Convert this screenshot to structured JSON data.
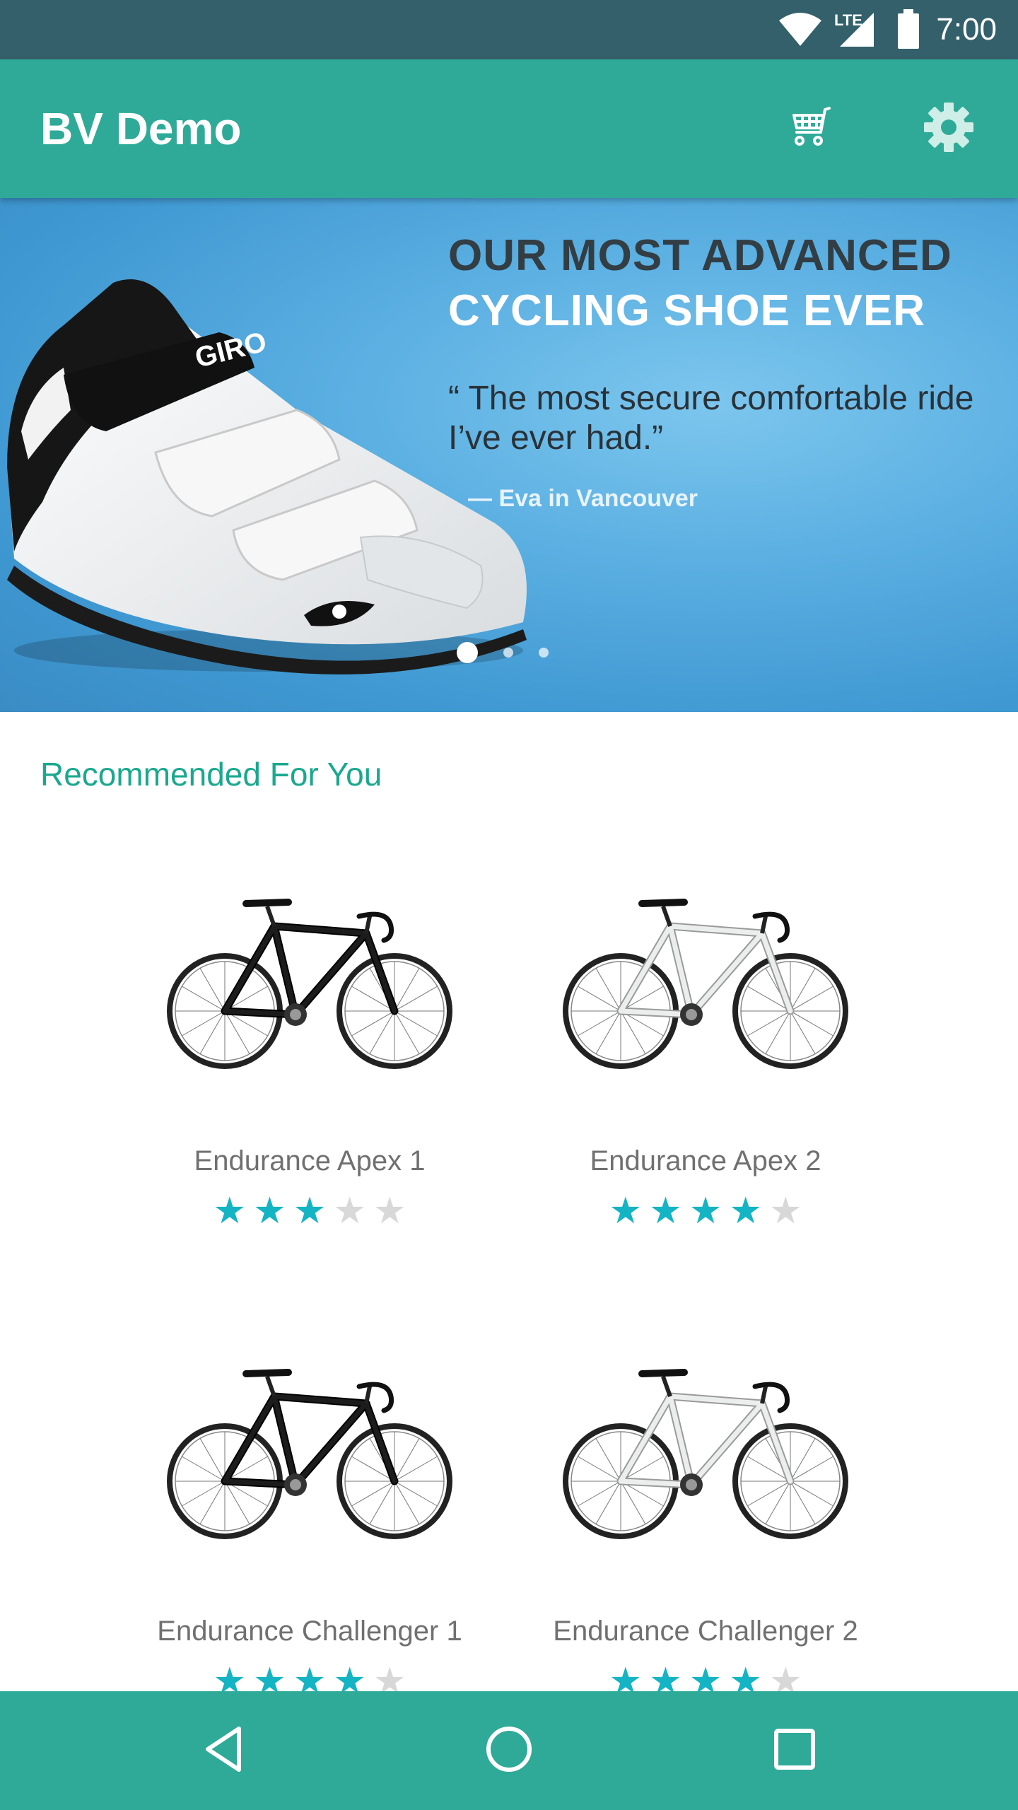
{
  "status_bar": {
    "time": "7:00",
    "icons": [
      "wifi-icon",
      "lte-signal-icon",
      "battery-icon"
    ],
    "network_label": "LTE"
  },
  "app_bar": {
    "title": "BV Demo",
    "actions": [
      "cart-icon",
      "settings-gear-icon"
    ]
  },
  "hero": {
    "headline_line1": "OUR MOST ADVANCED",
    "headline_line2": "CYCLING SHOE EVER",
    "quote": "“ The most secure comfortable ride I’ve ever had.”",
    "attribution": "— Eva in Vancouver",
    "brand_mark": "GIRO",
    "pager_count": 3,
    "pager_active": 0
  },
  "recommended": {
    "section_title": "Recommended For You",
    "products": [
      {
        "name": "Endurance Apex 1",
        "rating": 3,
        "max_rating": 5,
        "bike_color": "black"
      },
      {
        "name": "Endurance Apex 2",
        "rating": 4,
        "max_rating": 5,
        "bike_color": "white"
      },
      {
        "name": "Endurance Challenger 1",
        "rating": 4,
        "max_rating": 5,
        "bike_color": "black"
      },
      {
        "name": "Endurance Challenger 2",
        "rating": 4,
        "max_rating": 5,
        "bike_color": "white"
      }
    ]
  },
  "nav_bar": {
    "buttons": [
      "back-icon",
      "home-icon",
      "recents-icon"
    ]
  },
  "colors": {
    "status_bar": "#33606b",
    "primary": "#2faa98",
    "accent_text": "#1aa88f",
    "star_on": "#14b4c4",
    "star_off": "#d8d8d8"
  }
}
